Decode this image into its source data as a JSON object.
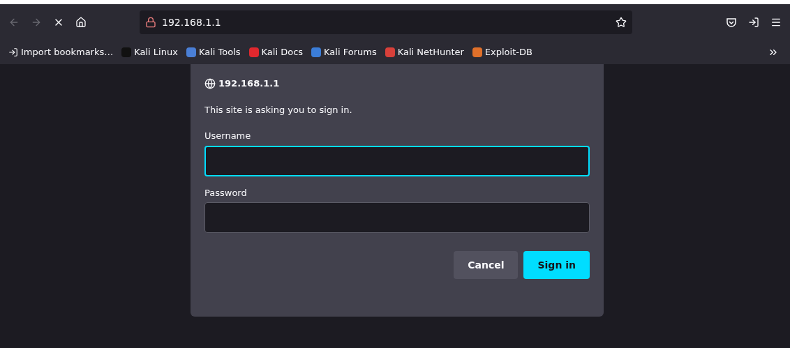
{
  "toolbar": {
    "url": "192.168.1.1",
    "loading": true
  },
  "bookmarks": [
    {
      "label": "Import bookmarks…",
      "kind": "import"
    },
    {
      "label": "Kali Linux",
      "kind": "site",
      "color": "#111111"
    },
    {
      "label": "Kali Tools",
      "kind": "site",
      "color": "#4a7fd6"
    },
    {
      "label": "Kali Docs",
      "kind": "site",
      "color": "#e0282e"
    },
    {
      "label": "Kali Forums",
      "kind": "site",
      "color": "#3b7dd8"
    },
    {
      "label": "Kali NetHunter",
      "kind": "site",
      "color": "#d8403a"
    },
    {
      "label": "Exploit-DB",
      "kind": "site",
      "color": "#e0702a"
    }
  ],
  "dialog": {
    "site": "192.168.1.1",
    "message": "This site is asking you to sign in.",
    "fields": [
      {
        "label": "Username",
        "focused": true
      },
      {
        "label": "Password",
        "focused": false
      }
    ],
    "buttons": [
      {
        "label": "Cancel",
        "kind": "secondary"
      },
      {
        "label": "Sign in",
        "kind": "primary"
      }
    ]
  }
}
